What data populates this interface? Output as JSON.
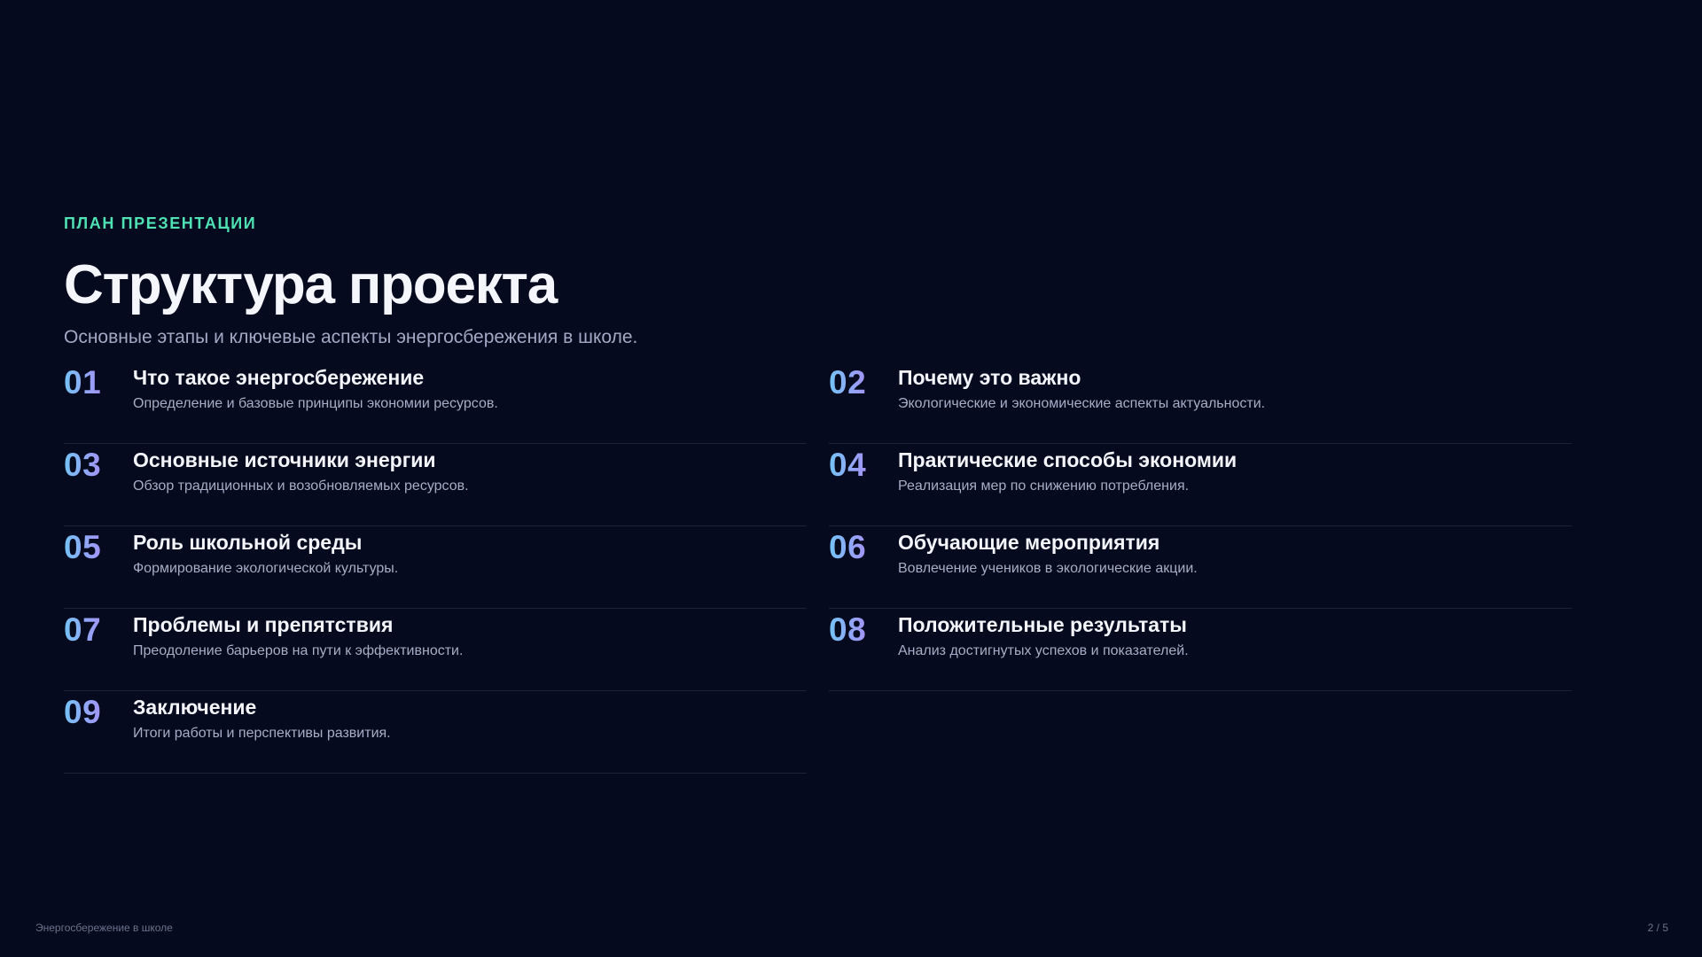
{
  "slide": {
    "kicker": "ПЛАН ПРЕЗЕНТАЦИИ",
    "title": "Структура проекта",
    "subtitle": "Основные этапы и ключевые аспекты энергосбережения в школе."
  },
  "items": [
    {
      "num": "01",
      "title": "Что такое энергосбережение",
      "desc": "Определение и базовые принципы экономии ресурсов."
    },
    {
      "num": "02",
      "title": "Почему это важно",
      "desc": "Экологические и экономические аспекты актуальности."
    },
    {
      "num": "03",
      "title": "Основные источники энергии",
      "desc": "Обзор традиционных и возобновляемых ресурсов."
    },
    {
      "num": "04",
      "title": "Практические способы экономии",
      "desc": "Реализация мер по снижению потребления."
    },
    {
      "num": "05",
      "title": "Роль школьной среды",
      "desc": "Формирование экологической культуры."
    },
    {
      "num": "06",
      "title": "Обучающие мероприятия",
      "desc": "Вовлечение учеников в экологические акции."
    },
    {
      "num": "07",
      "title": "Проблемы и препятствия",
      "desc": "Преодоление барьеров на пути к эффективности."
    },
    {
      "num": "08",
      "title": "Положительные результаты",
      "desc": "Анализ достигнутых успехов и показателей."
    },
    {
      "num": "09",
      "title": "Заключение",
      "desc": "Итоги работы и перспективы развития."
    }
  ],
  "footer": {
    "left": "Энергосбережение в школе",
    "right": "2 / 5"
  },
  "colors": {
    "background": "#060a1e",
    "accent": "#4fe1b3",
    "number_gradient_start": "#74c3f7",
    "number_gradient_end": "#a394f5"
  }
}
